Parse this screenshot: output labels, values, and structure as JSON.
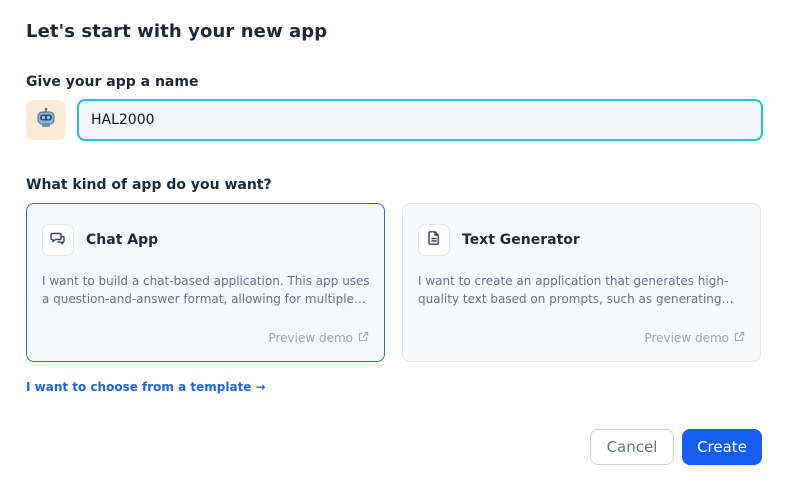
{
  "dialog": {
    "title": "Let's start with your new app"
  },
  "name_section": {
    "label": "Give your app a name",
    "avatar_icon": "robot-icon",
    "input_value": "HAL2000"
  },
  "kind_section": {
    "label": "What kind of app do you want?",
    "options": [
      {
        "title": "Chat App",
        "icon": "chat-bubbles-icon",
        "description": "I want to build a chat-based application. This app uses a question-and-answer format, allowing for multiple…",
        "preview_label": "Preview demo",
        "selected": true
      },
      {
        "title": "Text Generator",
        "icon": "document-icon",
        "description": "I want to create an application that generates high-quality text based on prompts, such as generating…",
        "preview_label": "Preview demo",
        "selected": false
      }
    ]
  },
  "template_link": {
    "label": "I want to choose from a template",
    "arrow": "→"
  },
  "footer": {
    "cancel_label": "Cancel",
    "create_label": "Create"
  },
  "colors": {
    "accent": "#155eef",
    "selected_border": "#2d6be4",
    "input_focus_border": "#22c3d4",
    "avatar_bg": "#ffead5"
  }
}
